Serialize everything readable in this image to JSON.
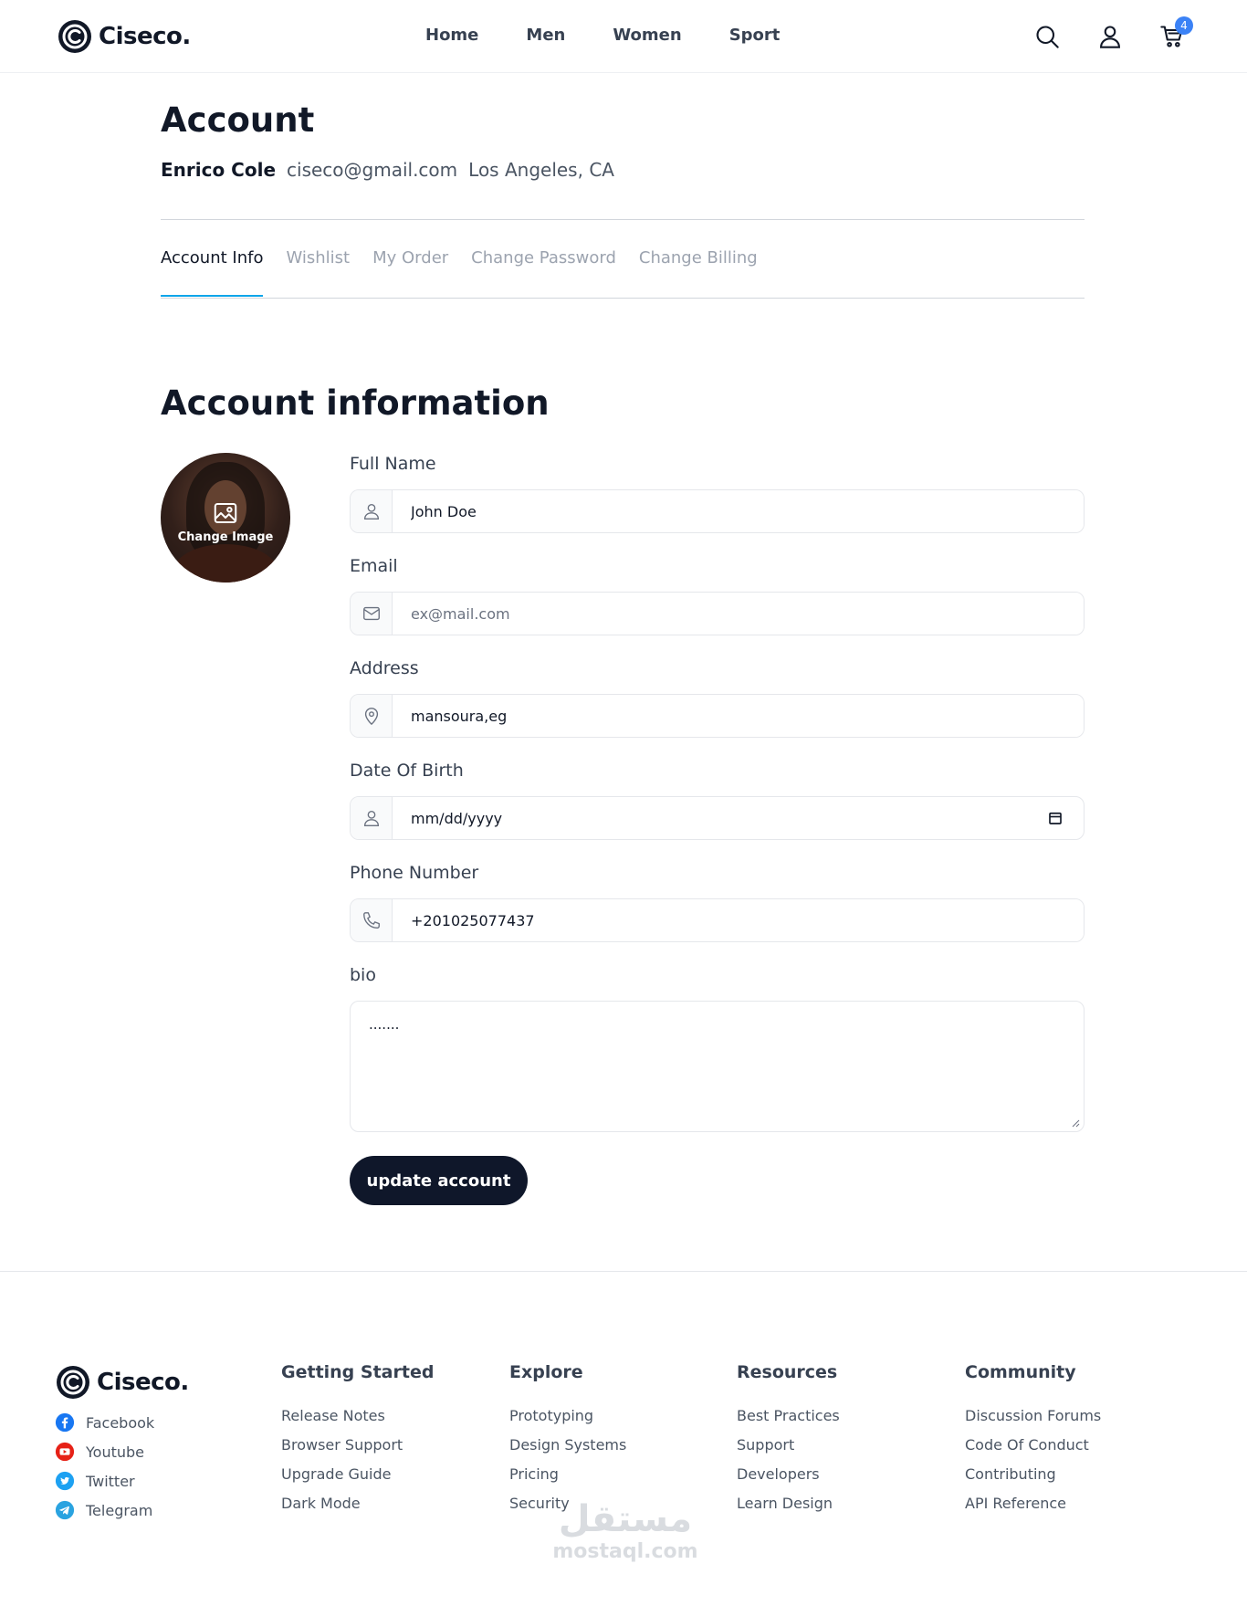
{
  "header": {
    "brand": "Ciseco.",
    "nav": [
      "Home",
      "Men",
      "Women",
      "Sport"
    ],
    "cart_count": "4"
  },
  "account": {
    "title": "Account",
    "user_name": "Enrico Cole",
    "user_email": "ciseco@gmail.com",
    "user_location": "Los Angeles, CA",
    "tabs": [
      "Account Info",
      "Wishlist",
      "My Order",
      "Change Password",
      "Change Billing"
    ],
    "active_tab": "Account Info"
  },
  "section": {
    "title": "Account information",
    "change_image_label": "Change Image"
  },
  "form": {
    "full_name_label": "Full Name",
    "full_name_value": "John Doe",
    "email_label": "Email",
    "email_placeholder": "ex@mail.com",
    "address_label": "Address",
    "address_value": "mansoura,eg",
    "dob_label": "Date Of Birth",
    "dob_placeholder": "mm/dd/yyyy",
    "phone_label": "Phone Number",
    "phone_value": "+201025077437",
    "bio_label": "bio",
    "bio_value": ".......",
    "submit_label": "update account"
  },
  "footer": {
    "brand": "Ciseco.",
    "social": [
      {
        "label": "Facebook",
        "icon": "facebook-icon",
        "color": "#1877f2"
      },
      {
        "label": "Youtube",
        "icon": "youtube-icon",
        "color": "#e62117"
      },
      {
        "label": "Twitter",
        "icon": "twitter-icon",
        "color": "#1da1f2"
      },
      {
        "label": "Telegram",
        "icon": "telegram-icon",
        "color": "#2aa3e0"
      }
    ],
    "columns": [
      {
        "title": "Getting Started",
        "links": [
          "Release Notes",
          "Browser Support",
          "Upgrade Guide",
          "Dark Mode"
        ]
      },
      {
        "title": "Explore",
        "links": [
          "Prototyping",
          "Design Systems",
          "Pricing",
          "Security"
        ]
      },
      {
        "title": "Resources",
        "links": [
          "Best Practices",
          "Support",
          "Developers",
          "Learn Design"
        ]
      },
      {
        "title": "Community",
        "links": [
          "Discussion Forums",
          "Code Of Conduct",
          "Contributing",
          "API Reference"
        ]
      }
    ]
  },
  "watermark": {
    "arabic": "مستقل",
    "latin": "mostaql.com"
  },
  "colors": {
    "accent": "#0ea5e9",
    "badge": "#3b82f6",
    "button": "#0f172a"
  }
}
